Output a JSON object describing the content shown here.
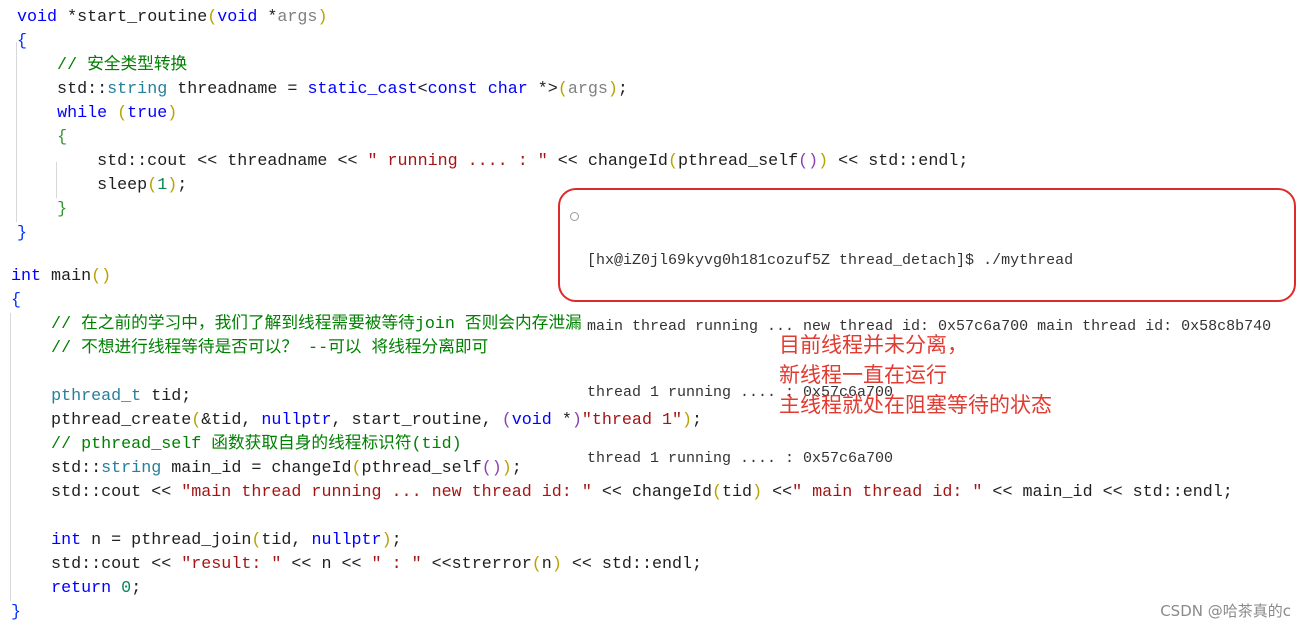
{
  "editor": {
    "function_block": [
      [
        [
          "void",
          "k"
        ],
        [
          " *start_routine",
          ""
        ],
        [
          "(",
          "p1"
        ],
        [
          "void",
          "k"
        ],
        [
          " *",
          ""
        ],
        [
          "args",
          "g"
        ],
        [
          ")",
          "p1"
        ]
      ],
      [
        [
          "{",
          "b1"
        ]
      ],
      [
        [
          "    // 安全类型转换",
          "c"
        ]
      ],
      [
        [
          "    std::",
          ""
        ],
        [
          "string",
          "t"
        ],
        [
          " threadname = ",
          ""
        ],
        [
          "static_cast",
          "k"
        ],
        [
          "<",
          ""
        ],
        [
          "const",
          "k"
        ],
        [
          " ",
          ""
        ],
        [
          "char",
          "k"
        ],
        [
          " *>",
          ""
        ],
        [
          "(",
          "p1"
        ],
        [
          "args",
          "g"
        ],
        [
          ")",
          "p1"
        ],
        [
          ";",
          ""
        ]
      ],
      [
        [
          "    ",
          ""
        ],
        [
          "while",
          "k"
        ],
        [
          " ",
          ""
        ],
        [
          "(",
          "p1"
        ],
        [
          "true",
          "k"
        ],
        [
          ")",
          "p1"
        ]
      ],
      [
        [
          "    ",
          ""
        ],
        [
          "{",
          "b2"
        ]
      ],
      [
        [
          "        std::cout << threadname << ",
          ""
        ],
        [
          "\" running .... : \"",
          "s"
        ],
        [
          " << changeId",
          ""
        ],
        [
          "(",
          "p1"
        ],
        [
          "pthread_self",
          ""
        ],
        [
          "()",
          "p2"
        ],
        [
          ")",
          "p1"
        ],
        [
          " << std::endl;",
          ""
        ]
      ],
      [
        [
          "        sleep",
          ""
        ],
        [
          "(",
          "p1"
        ],
        [
          "1",
          "n"
        ],
        [
          ")",
          "p1"
        ],
        [
          ";",
          ""
        ]
      ],
      [
        [
          "    ",
          ""
        ],
        [
          "}",
          "b2"
        ]
      ],
      [
        [
          "}",
          "b1"
        ]
      ]
    ],
    "main_block": [
      [
        [
          "int",
          "k"
        ],
        [
          " main",
          ""
        ],
        [
          "()",
          "p1"
        ]
      ],
      [
        [
          "{",
          "b1"
        ]
      ],
      [
        [
          "    // 在之前的学习中，我们了解到线程需要被等待join 否则会内存泄漏",
          "c"
        ]
      ],
      [
        [
          "    // 不想进行线程等待是否可以？ --可以 将线程分离即可",
          "c"
        ]
      ],
      [
        [
          "",
          ""
        ]
      ],
      [
        [
          "    ",
          ""
        ],
        [
          "pthread_t",
          "t"
        ],
        [
          " tid;",
          ""
        ]
      ],
      [
        [
          "    pthread_create",
          ""
        ],
        [
          "(",
          "p1"
        ],
        [
          "&tid, ",
          ""
        ],
        [
          "nullptr",
          "k"
        ],
        [
          ", start_routine, ",
          ""
        ],
        [
          "(",
          "p2"
        ],
        [
          "void",
          "k"
        ],
        [
          " *",
          ""
        ],
        [
          ")",
          "p2"
        ],
        [
          "\"thread 1\"",
          "s"
        ],
        [
          ")",
          "p1"
        ],
        [
          ";",
          ""
        ]
      ],
      [
        [
          "    // pthread_self 函数获取自身的线程标识符(tid)",
          "c"
        ]
      ],
      [
        [
          "    std::",
          ""
        ],
        [
          "string",
          "t"
        ],
        [
          " main_id = changeId",
          ""
        ],
        [
          "(",
          "p1"
        ],
        [
          "pthread_self",
          ""
        ],
        [
          "()",
          "p2"
        ],
        [
          ")",
          "p1"
        ],
        [
          ";",
          ""
        ]
      ],
      [
        [
          "    std::cout << ",
          ""
        ],
        [
          "\"main thread running ... new thread id: \"",
          "s"
        ],
        [
          " << changeId",
          ""
        ],
        [
          "(",
          "p1"
        ],
        [
          "tid",
          ""
        ],
        [
          ")",
          "p1"
        ],
        [
          " <<",
          ""
        ],
        [
          "\" main thread id: \"",
          "s"
        ],
        [
          " << main_id << std::endl;",
          ""
        ]
      ],
      [
        [
          "",
          ""
        ]
      ],
      [
        [
          "    ",
          ""
        ],
        [
          "int",
          "k"
        ],
        [
          " n = pthread_join",
          ""
        ],
        [
          "(",
          "p1"
        ],
        [
          "tid, ",
          ""
        ],
        [
          "nullptr",
          "k"
        ],
        [
          ")",
          "p1"
        ],
        [
          ";",
          ""
        ]
      ],
      [
        [
          "    std::cout << ",
          ""
        ],
        [
          "\"result: \"",
          "s"
        ],
        [
          " << n << ",
          ""
        ],
        [
          "\" : \"",
          "s"
        ],
        [
          " <<strerror",
          ""
        ],
        [
          "(",
          "p1"
        ],
        [
          "n",
          ""
        ],
        [
          ")",
          "p1"
        ],
        [
          " << std::endl;",
          ""
        ]
      ],
      [
        [
          "    ",
          ""
        ],
        [
          "return",
          "k"
        ],
        [
          " ",
          ""
        ],
        [
          "0",
          "n"
        ],
        [
          ";",
          ""
        ]
      ],
      [
        [
          "}",
          "b1"
        ]
      ]
    ]
  },
  "terminal": {
    "border_color": "#e0292b",
    "icon": "circle-prompt-icon",
    "lines": [
      "[hx@iZ0jl69kyvg0h181cozuf5Z thread_detach]$ ./mythread",
      "main thread running ... new thread id: 0x57c6a700 main thread id: 0x58c8b740",
      "thread 1 running .... : 0x57c6a700",
      "thread 1 running .... : 0x57c6a700"
    ]
  },
  "annotation": {
    "color": "#e23b32",
    "lines": [
      "目前线程并未分离，",
      "新线程一直在运行",
      "主线程就处在阻塞等待的状态"
    ]
  },
  "watermark": "CSDN @哈茶真的c"
}
